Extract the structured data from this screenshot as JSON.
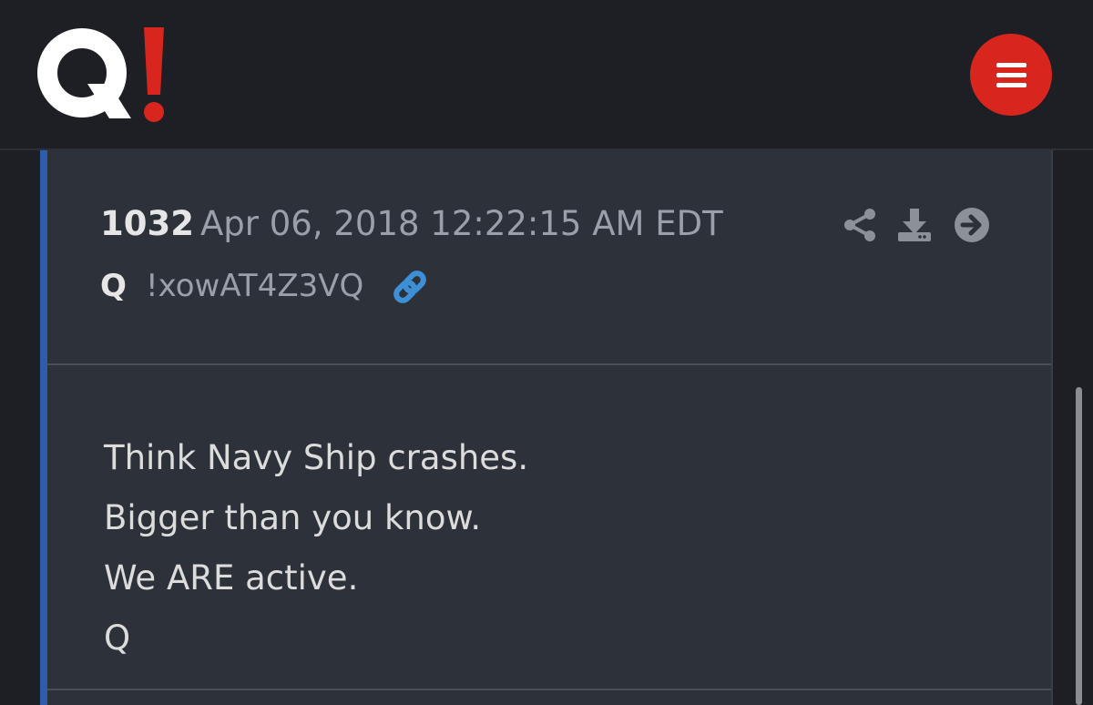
{
  "header": {
    "logo_text": "Q!",
    "menu_icon": "hamburger-menu-icon"
  },
  "post": {
    "number": "1032",
    "date": "Apr 06, 2018 12:22:15 AM EDT",
    "author": "Q",
    "tripcode": "!xowAT4Z3VQ",
    "actions": [
      "share-icon",
      "download-icon",
      "arrow-right-circle-icon"
    ],
    "body_lines": [
      "Think Navy Ship crashes.",
      "Bigger than you know.",
      "We ARE active.",
      "Q"
    ]
  },
  "colors": {
    "background": "#1d1f24",
    "card": "#2d3139",
    "accent_bar": "#2e5dad",
    "logo_red": "#d8261f",
    "link_blue": "#3d8fd6",
    "muted_text": "#9aa0a9"
  }
}
